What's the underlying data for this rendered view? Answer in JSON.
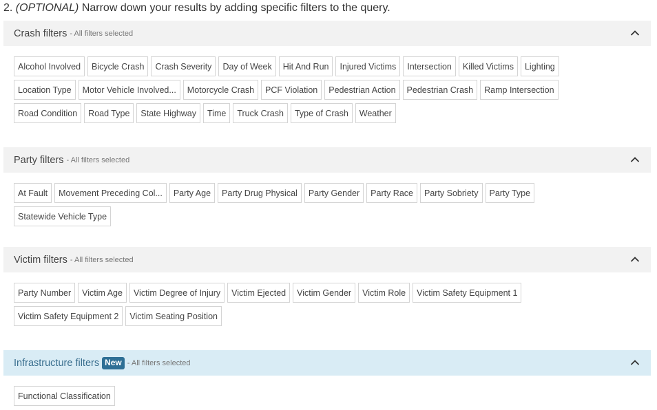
{
  "step": {
    "number": "2.",
    "optional": "(OPTIONAL)",
    "text": "Narrow down your results by adding specific filters to the query."
  },
  "sections": {
    "crash": {
      "title": "Crash filters",
      "subtitle": "- All filters selected",
      "chips": [
        "Alcohol Involved",
        "Bicycle Crash",
        "Crash Severity",
        "Day of Week",
        "Hit And Run",
        "Injured Victims",
        "Intersection",
        "Killed Victims",
        "Lighting",
        "Location Type",
        "Motor Vehicle Involved...",
        "Motorcycle Crash",
        "PCF Violation",
        "Pedestrian Action",
        "Pedestrian Crash",
        "Ramp Intersection",
        "Road Condition",
        "Road Type",
        "State Highway",
        "Time",
        "Truck Crash",
        "Type of Crash",
        "Weather"
      ]
    },
    "party": {
      "title": "Party filters",
      "subtitle": "- All filters selected",
      "chips": [
        "At Fault",
        "Movement Preceding Col...",
        "Party Age",
        "Party Drug Physical",
        "Party Gender",
        "Party Race",
        "Party Sobriety",
        "Party Type",
        "Statewide Vehicle Type"
      ]
    },
    "victim": {
      "title": "Victim filters",
      "subtitle": "- All filters selected",
      "chips": [
        "Party Number",
        "Victim Age",
        "Victim Degree of Injury",
        "Victim Ejected",
        "Victim Gender",
        "Victim Role",
        "Victim Safety Equipment 1",
        "Victim Safety Equipment 2",
        "Victim Seating Position"
      ]
    },
    "infrastructure": {
      "title": "Infrastructure filters",
      "badge": "New",
      "subtitle": "- All filters selected",
      "chips": [
        "Functional Classification"
      ]
    }
  },
  "icons": {
    "collapse": "chevron-up-icon"
  },
  "colors": {
    "header_bg": "#f2f2f2",
    "infra_header_bg": "#d9ecf5",
    "badge_bg": "#2e6f95",
    "chip_border": "#d4d4d4"
  }
}
